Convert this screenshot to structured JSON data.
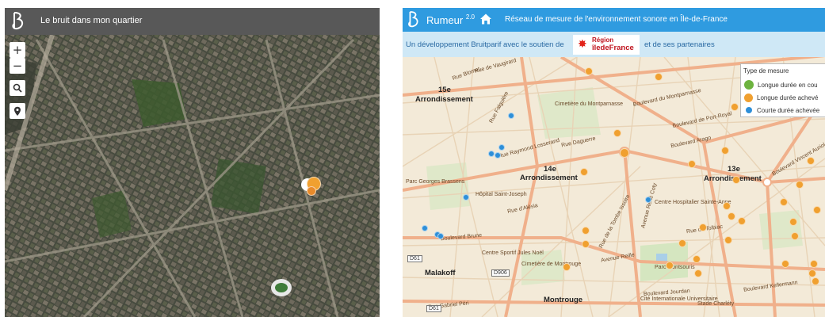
{
  "left_app": {
    "title": "Le bruit dans mon quartier",
    "controls": [
      "+",
      "−"
    ]
  },
  "right_app": {
    "app_name": "Rumeur",
    "app_version": "2.0",
    "title": "Réseau de mesure de l'environnement sonore en Île-de-France",
    "subtitle_before": "Un développement Bruitparif avec le soutien de",
    "region_line1": "Région",
    "region_line2": "îledeFrance",
    "subtitle_after": "et de ses partenaires"
  },
  "legend": {
    "title": "Type de mesure",
    "items": [
      {
        "label": "Longue durée en cou",
        "color": "#6db33f"
      },
      {
        "label": "Longue durée achevé",
        "color": "#f0a030"
      },
      {
        "label": "Courte durée achevée",
        "color": "#2e8fd8"
      }
    ]
  },
  "map_labels": {
    "districts": [
      {
        "id": "15e",
        "text": "15e"
      },
      {
        "id": "arr15",
        "text": "Arrondissement"
      },
      {
        "id": "14e",
        "text": "14e"
      },
      {
        "id": "arr14",
        "text": "Arrondissement"
      },
      {
        "id": "13e",
        "text": "13e"
      },
      {
        "id": "arr13",
        "text": "Arrondissement"
      },
      {
        "id": "malakoff",
        "text": "Malakoff"
      },
      {
        "id": "montrouge",
        "text": "Montrouge"
      }
    ],
    "streets": [
      {
        "id": "s1",
        "text": "Rue Blomet"
      },
      {
        "id": "s2",
        "text": "Rue de Vaugirard"
      },
      {
        "id": "s3",
        "text": "Rue Falguière"
      },
      {
        "id": "s4",
        "text": "Boulevard du Montparnasse"
      },
      {
        "id": "s5",
        "text": "Boulevard de Port-Royal"
      },
      {
        "id": "s6",
        "text": "Boulevard Arago"
      },
      {
        "id": "s7",
        "text": "Rue Raymond Losserand"
      },
      {
        "id": "s8",
        "text": "Rue Daguerre"
      },
      {
        "id": "s9",
        "text": "Rue d'Alésia"
      },
      {
        "id": "s10",
        "text": "Rue de Tolbiac"
      },
      {
        "id": "s11",
        "text": "Avenue Reille"
      },
      {
        "id": "s12",
        "text": "Boulevard Brune"
      },
      {
        "id": "s13",
        "text": "Rue de la Tombe Issoire"
      },
      {
        "id": "s14",
        "text": "Avenue René Coty"
      },
      {
        "id": "s15",
        "text": "Rue Gabriel Péri"
      },
      {
        "id": "s16",
        "text": "Boulevard Jourdan"
      },
      {
        "id": "s17",
        "text": "Cimetière du Montparnasse"
      },
      {
        "id": "s18",
        "text": "Centre Sportif Jules Noël"
      },
      {
        "id": "s19",
        "text": "Cimetière de Montrouge"
      },
      {
        "id": "s20",
        "text": "Parc Montsouris"
      },
      {
        "id": "s21",
        "text": "Cité Internationale Universitaire"
      },
      {
        "id": "s22",
        "text": "Stade Charléty"
      },
      {
        "id": "s23",
        "text": "D61"
      },
      {
        "id": "s24",
        "text": "D906"
      },
      {
        "id": "s25",
        "text": "D61"
      },
      {
        "id": "s26",
        "text": "Parc Georges Brassens"
      },
      {
        "id": "s27",
        "text": "Boulevard Kellermann"
      },
      {
        "id": "s28",
        "text": "Boulevard Vincent Auriol"
      },
      {
        "id": "s29",
        "text": "Hôpital Saint-Joseph"
      },
      {
        "id": "s30",
        "text": "Centre Hospitalier Sainte-Anne"
      }
    ]
  }
}
